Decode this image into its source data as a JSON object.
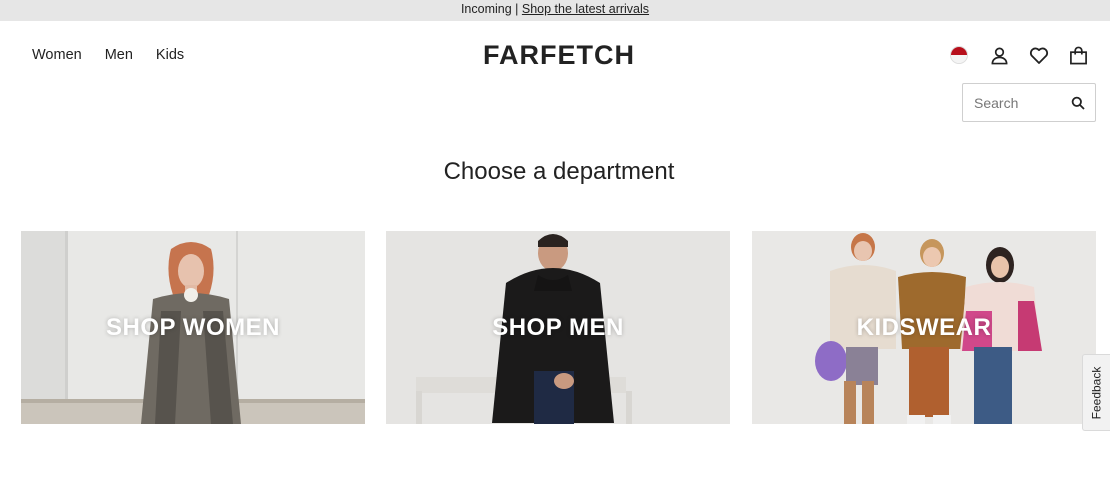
{
  "announcement": {
    "prefix": "Incoming |",
    "link": "Shop the latest arrivals"
  },
  "nav": {
    "items": [
      {
        "label": "Women"
      },
      {
        "label": "Men"
      },
      {
        "label": "Kids"
      }
    ]
  },
  "brand": {
    "logo": "FARFETCH"
  },
  "header_icons": {
    "flag": "japan-flag-icon",
    "account": "user-icon",
    "wishlist": "heart-icon",
    "bag": "shopping-bag-icon"
  },
  "search": {
    "placeholder": "Search",
    "value": ""
  },
  "main": {
    "heading": "Choose a department",
    "departments": [
      {
        "label": "SHOP WOMEN"
      },
      {
        "label": "SHOP MEN"
      },
      {
        "label": "KIDSWEAR"
      }
    ]
  },
  "feedback": {
    "label": "Feedback"
  },
  "colors": {
    "announcement_bg": "#e6e6e6",
    "text": "#222222",
    "flag_red": "#b70f1b"
  }
}
